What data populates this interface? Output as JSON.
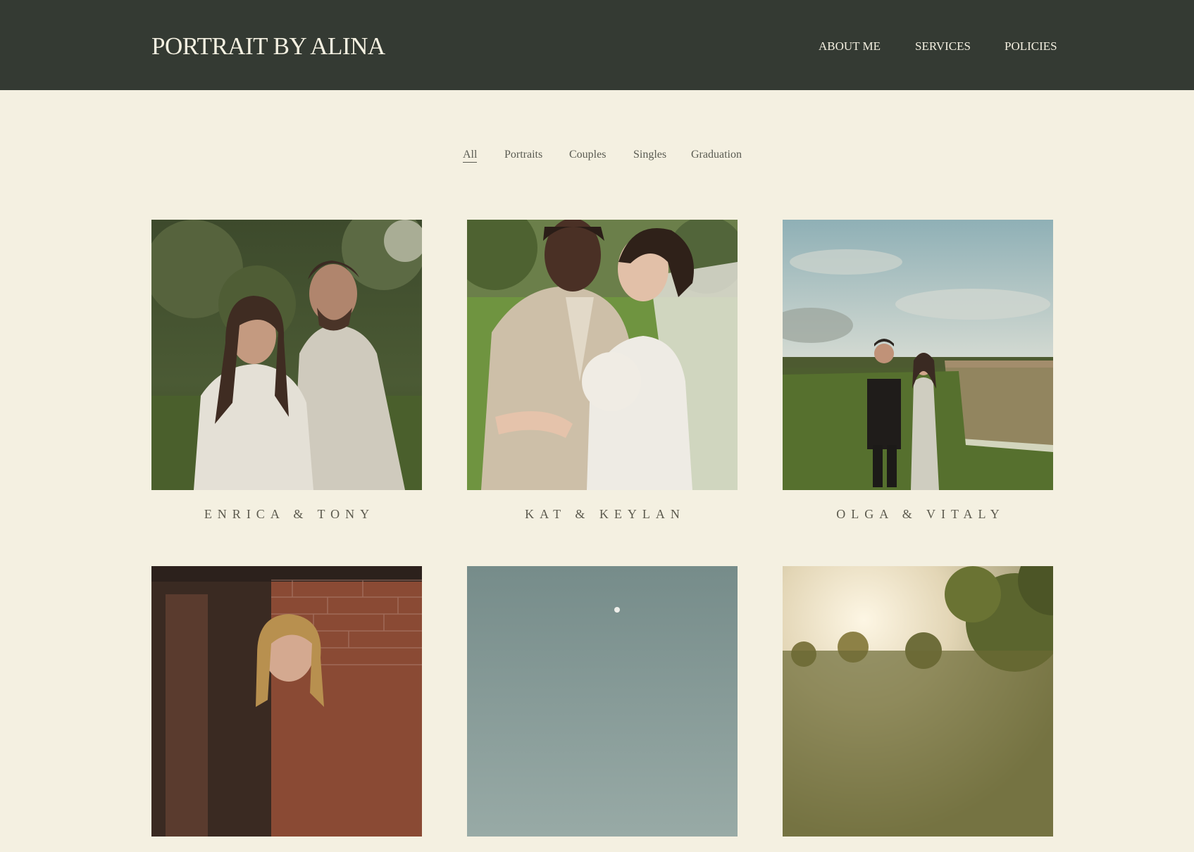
{
  "header": {
    "logo": "PORTRAIT BY ALINA",
    "nav": [
      "ABOUT ME",
      "SERVICES",
      "POLICIES"
    ]
  },
  "filters": {
    "items": [
      "All",
      "Portraits",
      "Couples",
      "Singles",
      "Graduation"
    ],
    "active": "All"
  },
  "gallery": {
    "items": [
      {
        "caption": "ENRICA & TONY"
      },
      {
        "caption": "KAT & KEYLAN"
      },
      {
        "caption": "OLGA & VITALY"
      },
      {
        "caption": ""
      },
      {
        "caption": ""
      },
      {
        "caption": ""
      }
    ]
  },
  "colors": {
    "header_bg": "#343a33",
    "page_bg": "#f4f0e1",
    "header_text": "#f4f0e1",
    "body_text": "#5a5b52"
  }
}
